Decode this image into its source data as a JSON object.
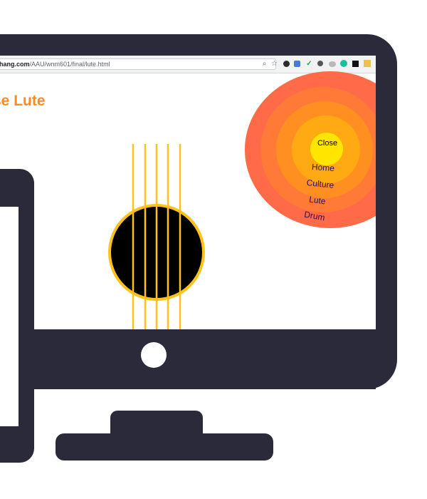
{
  "browser": {
    "url_domain": "hang.com",
    "url_path": "/AAU/wnm601/final/lute.html",
    "toolbar_icons": [
      "search-icon",
      "star-icon",
      "evernote-icon",
      "translate-icon",
      "check-icon",
      "pin-icon",
      "cloud-icon",
      "grammarly-icon",
      "jb-icon",
      "extension-icon"
    ]
  },
  "page": {
    "title": "se Lute"
  },
  "menu": {
    "close": "Close",
    "items": [
      "Home",
      "Culture",
      "Lute",
      "Drum"
    ]
  },
  "colors": {
    "monitor": "#2b2a3a",
    "title": "#ff8a1e",
    "string": "#ffc21a",
    "soundhole": "#000000",
    "ring_outer": "#ff6a48",
    "ring_center": "#ffe500",
    "menu_text": "#2c0f55"
  }
}
